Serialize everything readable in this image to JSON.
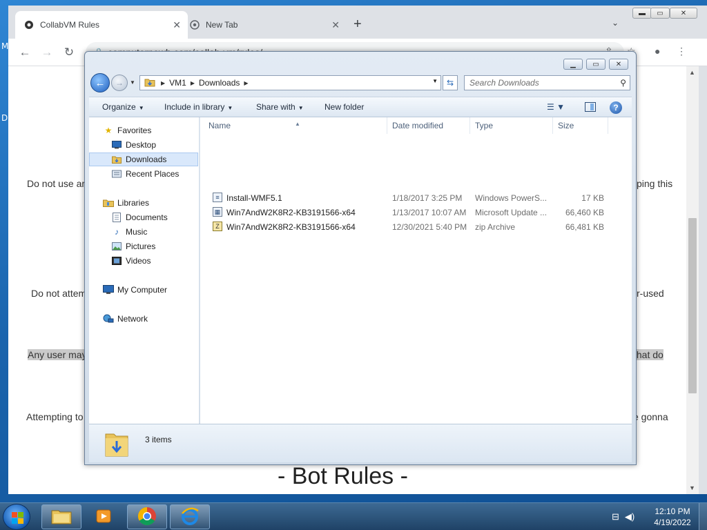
{
  "chrome": {
    "tabs": [
      {
        "title": "CollabVM Rules",
        "active": true
      },
      {
        "title": "New Tab",
        "active": false
      }
    ],
    "url": "computernewb.com/collab-vm/rules/",
    "new_tab_symbol": "+",
    "window_buttons": {
      "minimize": "▬",
      "maximize": "▭",
      "close": "✕"
    }
  },
  "webpage": {
    "lines": [
      {
        "left": "Do not use ar",
        "right": "ping this"
      },
      {
        "left": "Do not attem",
        "right": "r-used"
      },
      {
        "left": "Any user may",
        "right": "that do"
      },
      {
        "left": "Attempting to",
        "right": "e gonna"
      }
    ],
    "heading": "- Bot Rules -"
  },
  "explorer": {
    "address_segments": [
      "VM1",
      "Downloads"
    ],
    "search_placeholder": "Search Downloads",
    "commands": {
      "organize": "Organize",
      "include_in_library": "Include in library",
      "share_with": "Share with",
      "new_folder": "New folder"
    },
    "nav": {
      "favorites": {
        "label": "Favorites",
        "items": [
          "Desktop",
          "Downloads",
          "Recent Places"
        ]
      },
      "libraries": {
        "label": "Libraries",
        "items": [
          "Documents",
          "Music",
          "Pictures",
          "Videos"
        ]
      },
      "my_computer": "My Computer",
      "network": "Network"
    },
    "columns": [
      "Name",
      "Date modified",
      "Type",
      "Size"
    ],
    "files": [
      {
        "name": "Install-WMF5.1",
        "date": "1/18/2017 3:25 PM",
        "type": "Windows PowerS...",
        "size": "17 KB",
        "icon": "script-icon"
      },
      {
        "name": "Win7AndW2K8R2-KB3191566-x64",
        "date": "1/13/2017 10:07 AM",
        "type": "Microsoft Update ...",
        "size": "66,460 KB",
        "icon": "msu-icon"
      },
      {
        "name": "Win7AndW2K8R2-KB3191566-x64",
        "date": "12/30/2021 5:40 PM",
        "type": "zip Archive",
        "size": "66,481 KB",
        "icon": "zip-icon"
      }
    ],
    "status": "3 items"
  },
  "taskbar": {
    "time": "12:10 PM",
    "date": "4/19/2022"
  }
}
